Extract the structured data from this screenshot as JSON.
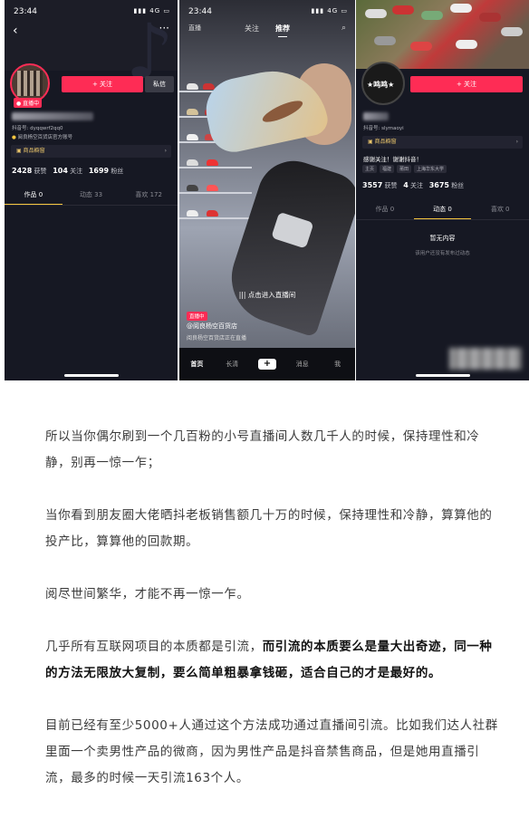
{
  "phone1": {
    "time": "23:44",
    "signal": "4G",
    "live_badge": "● 直播中",
    "follow_button": "+ 关注",
    "message_button": "私信",
    "douyin_id": "抖音号: dyqqwrf2qq0",
    "verified": "阅良杨空百货店官方账号",
    "shop_window": "商品橱窗",
    "likes_count": "2428",
    "likes_label": "获赞",
    "following_count": "104",
    "following_label": "关注",
    "followers_count": "1699",
    "followers_label": "粉丝",
    "tabs": [
      "作品 0",
      "动态 33",
      "喜欢 172"
    ]
  },
  "phone2": {
    "time": "23:44",
    "signal": "4G",
    "nav_live": "直播",
    "nav_follow": "关注",
    "nav_recommend": "推荐",
    "search_icon": "⌕",
    "enter_live": "|||  点击进入直播间",
    "live_tag": "直播中",
    "username": "@阅良杨空百货店",
    "desc": "阅良杨空百货店正在直播",
    "bottom_nav": [
      "首页",
      "长清",
      "+",
      "消息",
      "我"
    ]
  },
  "phone3": {
    "follow_button": "+ 关注",
    "douyin_id": "抖音号: slymaoyi",
    "shop_window": "商品橱窗",
    "bio": "感谢关注！谢谢抖音！",
    "tags": [
      "主页",
      "福建",
      "莆田",
      "上海华东大学"
    ],
    "likes_count": "3557",
    "likes_label": "获赞",
    "following_count": "4",
    "following_label": "关注",
    "followers_count": "3675",
    "followers_label": "粉丝",
    "tabs": [
      "作品 0",
      "动态 0",
      "喜欢 0"
    ],
    "empty_title": "暂无内容",
    "empty_sub": "该用户还没有发布过动态"
  },
  "article": {
    "p1": "所以当你偶尔刷到一个几百粉的小号直播间人数几千人的时候，保持理性和冷静，别再一惊一乍；",
    "p2": "当你看到朋友圈大佬晒抖老板销售额几十万的时候，保持理性和冷静，算算他的投产比，算算他的回款期。",
    "p3": "阅尽世间繁华，才能不再一惊一乍。",
    "p4_normal": "几乎所有互联网项目的本质都是引流，",
    "p4_bold": "而引流的本质要么是量大出奇迹，同一种的方法无限放大复制，要么简单粗暴拿钱砸，适合自己的才是最好的。",
    "p5": "目前已经有至少5000+人通过这个方法成功通过直播间引流。比如我们达人社群里面一个卖男性产品的微商，因为男性产品是抖音禁售商品，但是她用直播引流，最多的时候一天引流163个人。"
  }
}
